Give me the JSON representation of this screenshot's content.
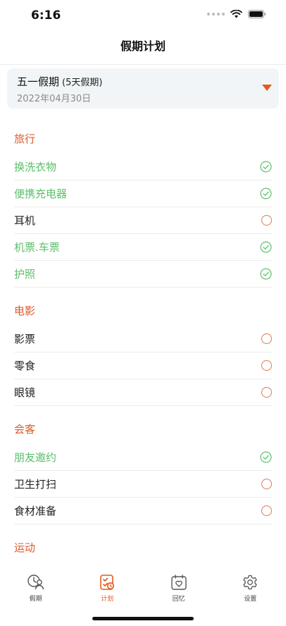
{
  "status": {
    "time": "6:16"
  },
  "nav": {
    "title": "假期计划"
  },
  "holiday": {
    "name": "五一假期",
    "days": "(5天假期)",
    "date": "2022年04月30日"
  },
  "sections": [
    {
      "title": "旅行",
      "items": [
        {
          "label": "换洗衣物",
          "done": true
        },
        {
          "label": "便携充电器",
          "done": true
        },
        {
          "label": "耳机",
          "done": false
        },
        {
          "label": "机票.车票",
          "done": true
        },
        {
          "label": "护照",
          "done": true
        }
      ]
    },
    {
      "title": "电影",
      "items": [
        {
          "label": "影票",
          "done": false
        },
        {
          "label": "零食",
          "done": false
        },
        {
          "label": "眼镜",
          "done": false
        }
      ]
    },
    {
      "title": "会客",
      "items": [
        {
          "label": "朋友邀约",
          "done": true
        },
        {
          "label": "卫生打扫",
          "done": false
        },
        {
          "label": "食材准备",
          "done": false
        }
      ]
    },
    {
      "title": "运动",
      "items": []
    }
  ],
  "tabs": [
    {
      "label": "假期",
      "icon": "holiday-people-icon",
      "active": false
    },
    {
      "label": "计划",
      "icon": "plan-checklist-icon",
      "active": true
    },
    {
      "label": "回忆",
      "icon": "calendar-heart-icon",
      "active": false
    },
    {
      "label": "设置",
      "icon": "gear-icon",
      "active": false
    }
  ],
  "colors": {
    "accent": "#e35a1d",
    "section_title": "#d95b2a",
    "done": "#5ac06b",
    "pending_circle": "#e0784f"
  }
}
